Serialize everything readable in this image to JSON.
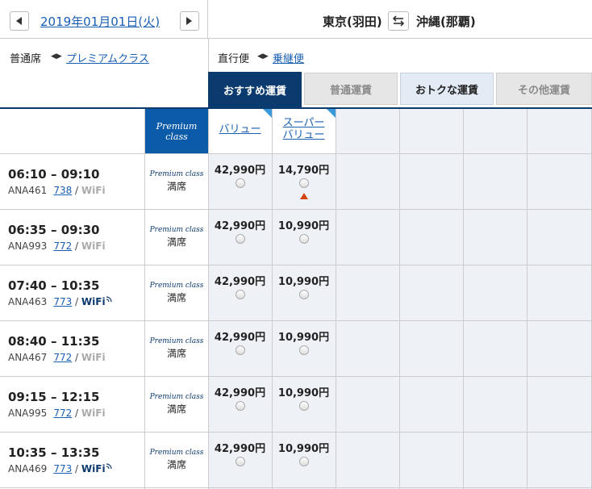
{
  "header": {
    "date_label": "2019年01月01日(火)",
    "origin": "東京(羽田)",
    "destination": "沖縄(那覇)"
  },
  "subheader": {
    "seat_current": "普通席",
    "seat_alt": "プレミアムクラス",
    "flight_current": "直行便",
    "flight_alt": "乗継便"
  },
  "fare_tabs": [
    "おすすめ運賃",
    "普通運賃",
    "おトクな運賃",
    "その他運賃"
  ],
  "table": {
    "pc_header_line1": "Premium",
    "pc_header_line2": "class",
    "fare_columns": [
      "バリュー",
      "スーパー",
      "バリュー"
    ],
    "pc_label": "Premium class",
    "pc_status": "満席",
    "currency_suffix": "円"
  },
  "flights": [
    {
      "time": "06:10 – 09:10",
      "flight_no": "ANA461",
      "aircraft": "738",
      "wifi": "WiFi",
      "wifi_available": false,
      "value": "42,990円",
      "super_value": "14,790円",
      "few_seats": true
    },
    {
      "time": "06:35 – 09:30",
      "flight_no": "ANA993",
      "aircraft": "772",
      "wifi": "WiFi",
      "wifi_available": false,
      "value": "42,990円",
      "super_value": "10,990円",
      "few_seats": false
    },
    {
      "time": "07:40 – 10:35",
      "flight_no": "ANA463",
      "aircraft": "773",
      "wifi": "WiFi",
      "wifi_available": true,
      "value": "42,990円",
      "super_value": "10,990円",
      "few_seats": false
    },
    {
      "time": "08:40 – 11:35",
      "flight_no": "ANA467",
      "aircraft": "772",
      "wifi": "WiFi",
      "wifi_available": false,
      "value": "42,990円",
      "super_value": "10,990円",
      "few_seats": false
    },
    {
      "time": "09:15 – 12:15",
      "flight_no": "ANA995",
      "aircraft": "772",
      "wifi": "WiFi",
      "wifi_available": false,
      "value": "42,990円",
      "super_value": "10,990円",
      "few_seats": false
    },
    {
      "time": "10:35 – 13:35",
      "flight_no": "ANA469",
      "aircraft": "773",
      "wifi": "WiFi",
      "wifi_available": true,
      "value": "42,990円",
      "super_value": "10,990円",
      "few_seats": false
    }
  ],
  "colors": {
    "brand_navy": "#0b3a6e",
    "link_blue": "#1a5fb4",
    "premium_blue": "#0b5ba8",
    "warning_orange": "#d2440f"
  }
}
